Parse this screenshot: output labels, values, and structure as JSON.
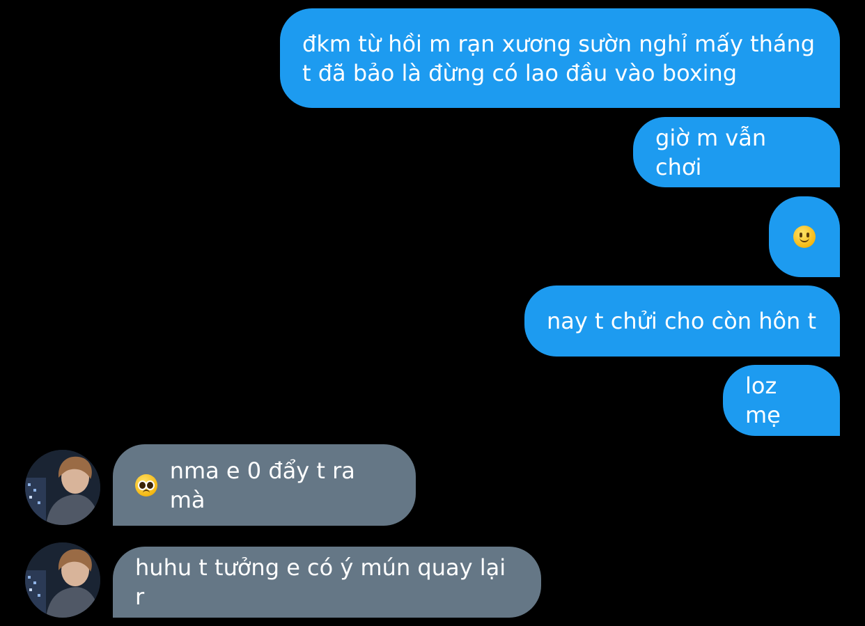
{
  "conversation": {
    "messages": [
      {
        "sender": "me",
        "text": "đkm từ hồi m rạn xương sườn nghỉ mấy tháng\nt đã bảo là đừng có lao đầu vào boxing"
      },
      {
        "sender": "me",
        "text": "giờ m vẫn chơi"
      },
      {
        "sender": "me",
        "emoji": "slightly-smiling-face-emoji"
      },
      {
        "sender": "me",
        "text": "nay t chửi cho còn hôn t"
      },
      {
        "sender": "me",
        "text": "loz mẹ"
      },
      {
        "sender": "other",
        "emoji": "pleading-face-emoji",
        "text": "nma e 0 đẩy t ra mà"
      },
      {
        "sender": "other",
        "text": "huhu t tưởng e có ý mún quay lại r"
      }
    ]
  },
  "colors": {
    "background": "#000000",
    "sent_bubble": "#1d9bf0",
    "received_bubble": "#657786",
    "text": "#ffffff"
  }
}
